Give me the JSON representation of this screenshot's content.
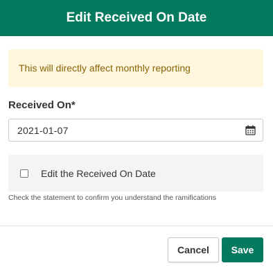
{
  "modal": {
    "title": "Edit Received On Date"
  },
  "warning": {
    "text": "This will directly affect monthly reporting"
  },
  "received_on": {
    "label": "Received On*",
    "value": "2021-01-07",
    "icon": "calendar-icon"
  },
  "confirm": {
    "checkbox_label": "Edit the Received On Date",
    "checked": false,
    "help_text": "Check the statement to confirm you understand the ramifications"
  },
  "footer": {
    "cancel_label": "Cancel",
    "save_label": "Save"
  },
  "colors": {
    "primary": "#067a5e",
    "warning_bg": "#fff6de",
    "warning_text": "#8a6406"
  }
}
